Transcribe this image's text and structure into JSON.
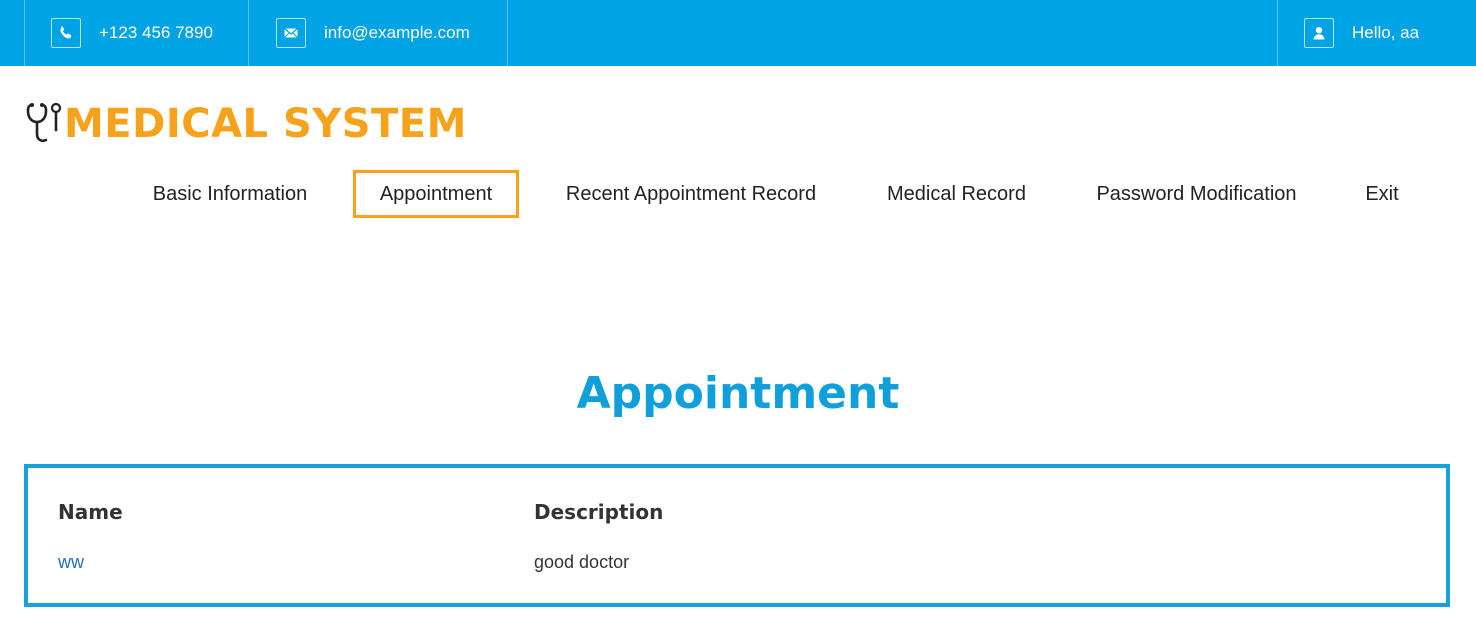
{
  "topbar": {
    "phone": "+123 456 7890",
    "email": "info@example.com",
    "greeting": "Hello, aa",
    "background": "#00a3e3"
  },
  "brand": {
    "name": "MEDICAL SYSTEM",
    "icon": "stethoscope-icon",
    "color": "#f7a21b"
  },
  "nav": {
    "items": [
      {
        "label": "Basic Information"
      },
      {
        "label": "Appointment",
        "active": true
      },
      {
        "label": "Recent Appointment Record"
      },
      {
        "label": "Medical Record"
      },
      {
        "label": "Password Modification"
      },
      {
        "label": "Exit"
      }
    ]
  },
  "main": {
    "title": "Appointment",
    "table": {
      "columns": [
        "Name",
        "Description"
      ],
      "rows": [
        {
          "name": "ww",
          "description": "good doctor"
        }
      ]
    }
  }
}
